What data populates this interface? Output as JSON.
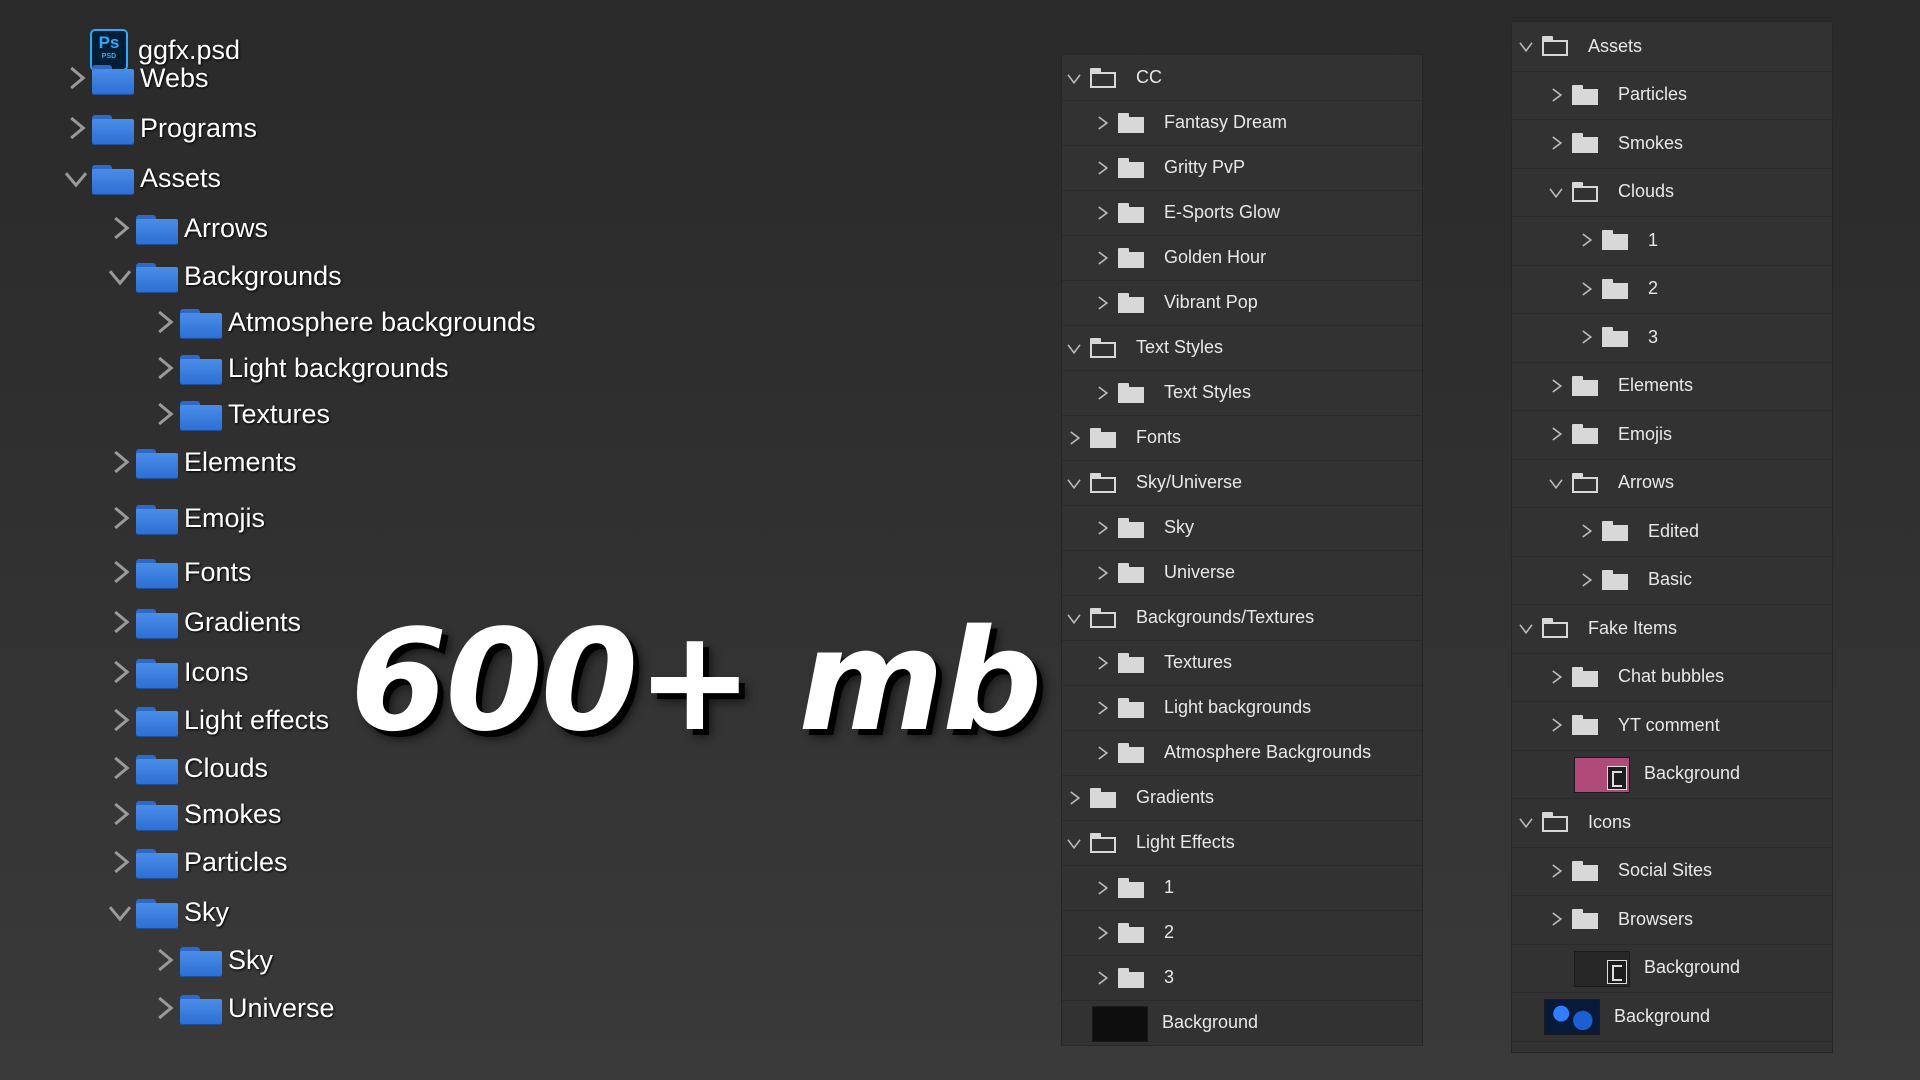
{
  "headline": "600+ mb",
  "explorer": {
    "root": {
      "label": "ggfx.psd",
      "icon": "photoshop-file-icon",
      "icon_text": "Ps",
      "icon_sub": "PSD"
    },
    "items": [
      {
        "label": "Webs",
        "expanded": false,
        "depth": 0
      },
      {
        "label": "Programs",
        "expanded": false,
        "depth": 0
      },
      {
        "label": "Assets",
        "expanded": true,
        "depth": 0
      },
      {
        "label": "Arrows",
        "expanded": false,
        "depth": 1
      },
      {
        "label": "Backgrounds",
        "expanded": true,
        "depth": 1
      },
      {
        "label": "Atmosphere backgrounds",
        "expanded": false,
        "depth": 2
      },
      {
        "label": "Light backgrounds",
        "expanded": false,
        "depth": 2
      },
      {
        "label": "Textures",
        "expanded": false,
        "depth": 2
      },
      {
        "label": "Elements",
        "expanded": false,
        "depth": 1
      },
      {
        "label": "Emojis",
        "expanded": false,
        "depth": 1
      },
      {
        "label": "Fonts",
        "expanded": false,
        "depth": 1
      },
      {
        "label": "Gradients",
        "expanded": false,
        "depth": 1
      },
      {
        "label": "Icons",
        "expanded": false,
        "depth": 1
      },
      {
        "label": "Light effects",
        "expanded": false,
        "depth": 1
      },
      {
        "label": "Clouds",
        "expanded": false,
        "depth": 1
      },
      {
        "label": "Smokes",
        "expanded": false,
        "depth": 1
      },
      {
        "label": "Particles",
        "expanded": false,
        "depth": 1
      },
      {
        "label": "Sky",
        "expanded": true,
        "depth": 1
      },
      {
        "label": "Sky",
        "expanded": false,
        "depth": 2
      },
      {
        "label": "Universe",
        "expanded": false,
        "depth": 2
      }
    ]
  },
  "layers_panel_1": {
    "rows": [
      {
        "label": "CC",
        "type": "group",
        "expanded": true,
        "depth": 0
      },
      {
        "label": "Fantasy Dream",
        "type": "group",
        "expanded": false,
        "depth": 1
      },
      {
        "label": "Gritty PvP",
        "type": "group",
        "expanded": false,
        "depth": 1
      },
      {
        "label": "E-Sports Glow",
        "type": "group",
        "expanded": false,
        "depth": 1
      },
      {
        "label": "Golden Hour",
        "type": "group",
        "expanded": false,
        "depth": 1
      },
      {
        "label": "Vibrant Pop",
        "type": "group",
        "expanded": false,
        "depth": 1
      },
      {
        "label": "Text Styles",
        "type": "group",
        "expanded": true,
        "depth": 0
      },
      {
        "label": "Text Styles",
        "type": "group",
        "expanded": false,
        "depth": 1
      },
      {
        "label": "Fonts",
        "type": "group",
        "expanded": false,
        "depth": 0
      },
      {
        "label": "Sky/Universe",
        "type": "group",
        "expanded": true,
        "depth": 0
      },
      {
        "label": "Sky",
        "type": "group",
        "expanded": false,
        "depth": 1
      },
      {
        "label": "Universe",
        "type": "group",
        "expanded": false,
        "depth": 1
      },
      {
        "label": "Backgrounds/Textures",
        "type": "group",
        "expanded": true,
        "depth": 0
      },
      {
        "label": "Textures",
        "type": "group",
        "expanded": false,
        "depth": 1
      },
      {
        "label": "Light backgrounds",
        "type": "group",
        "expanded": false,
        "depth": 1
      },
      {
        "label": "Atmosphere Backgrounds",
        "type": "group",
        "expanded": false,
        "depth": 1
      },
      {
        "label": "Gradients",
        "type": "group",
        "expanded": false,
        "depth": 0
      },
      {
        "label": "Light Effects",
        "type": "group",
        "expanded": true,
        "depth": 0
      },
      {
        "label": "1",
        "type": "group",
        "expanded": false,
        "depth": 1
      },
      {
        "label": "2",
        "type": "group",
        "expanded": false,
        "depth": 1
      },
      {
        "label": "3",
        "type": "group",
        "expanded": false,
        "depth": 1
      },
      {
        "label": "Background",
        "type": "layer",
        "thumb": "black",
        "depth": 0
      }
    ]
  },
  "layers_panel_2": {
    "rows": [
      {
        "label": "Assets",
        "type": "group",
        "expanded": true,
        "depth": 0
      },
      {
        "label": "Particles",
        "type": "group",
        "expanded": false,
        "depth": 1
      },
      {
        "label": "Smokes",
        "type": "group",
        "expanded": false,
        "depth": 1
      },
      {
        "label": "Clouds",
        "type": "group",
        "expanded": true,
        "depth": 1
      },
      {
        "label": "1",
        "type": "group",
        "expanded": false,
        "depth": 2
      },
      {
        "label": "2",
        "type": "group",
        "expanded": false,
        "depth": 2
      },
      {
        "label": "3",
        "type": "group",
        "expanded": false,
        "depth": 2
      },
      {
        "label": "Elements",
        "type": "group",
        "expanded": false,
        "depth": 1
      },
      {
        "label": "Emojis",
        "type": "group",
        "expanded": false,
        "depth": 1
      },
      {
        "label": "Arrows",
        "type": "group",
        "expanded": true,
        "depth": 1
      },
      {
        "label": "Edited",
        "type": "group",
        "expanded": false,
        "depth": 2
      },
      {
        "label": "Basic",
        "type": "group",
        "expanded": false,
        "depth": 2
      },
      {
        "label": "Fake Items",
        "type": "group",
        "expanded": true,
        "depth": 0
      },
      {
        "label": "Chat bubbles",
        "type": "group",
        "expanded": false,
        "depth": 1
      },
      {
        "label": "YT comment",
        "type": "group",
        "expanded": false,
        "depth": 1
      },
      {
        "label": "Background",
        "type": "layer",
        "thumb": "pink",
        "smart": true,
        "depth": 1
      },
      {
        "label": "Icons",
        "type": "group",
        "expanded": true,
        "depth": 0
      },
      {
        "label": "Social Sites",
        "type": "group",
        "expanded": false,
        "depth": 1
      },
      {
        "label": "Browsers",
        "type": "group",
        "expanded": false,
        "depth": 1
      },
      {
        "label": "Background",
        "type": "layer",
        "thumb": "dark",
        "smart": true,
        "depth": 1
      },
      {
        "label": "Background",
        "type": "layer",
        "thumb": "blue",
        "depth": 0
      }
    ]
  }
}
